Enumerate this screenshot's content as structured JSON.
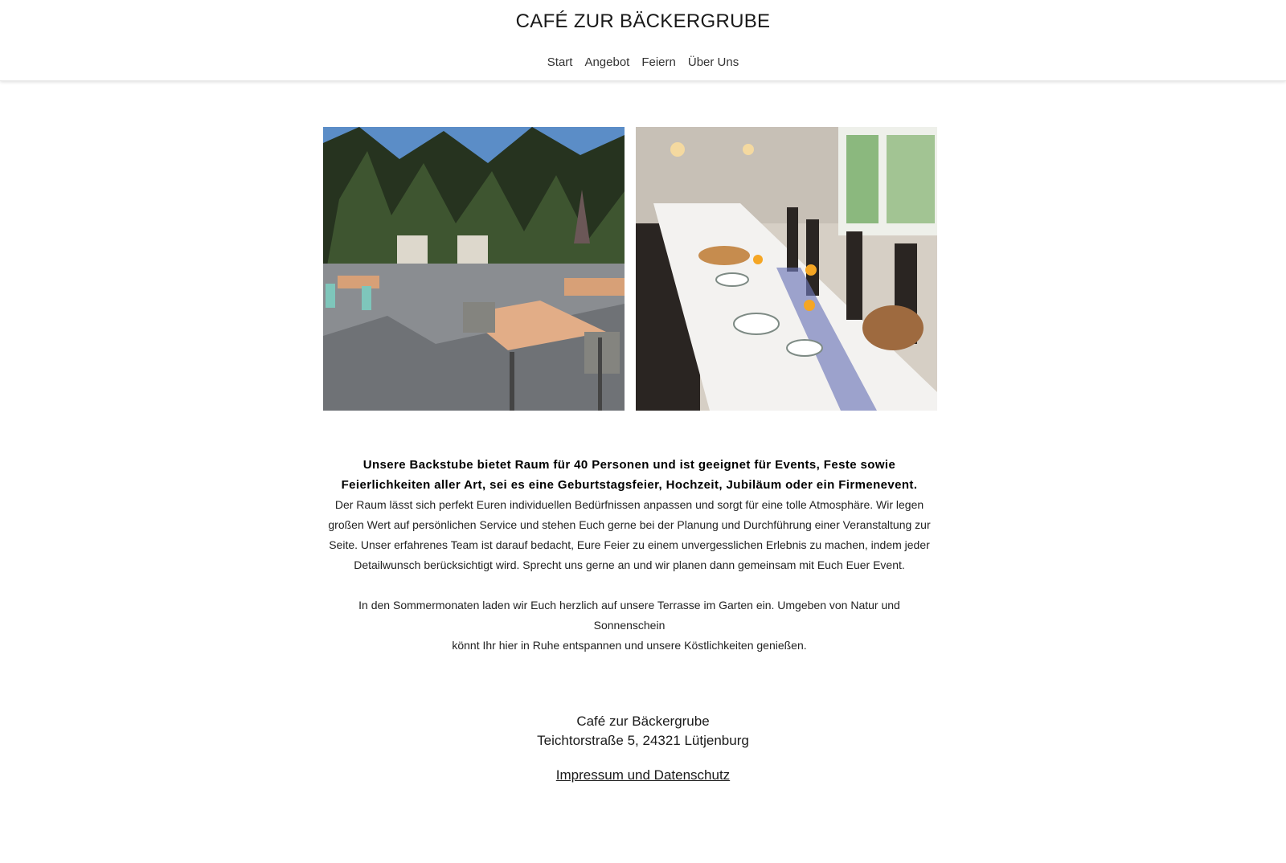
{
  "header": {
    "title": "CAFÉ ZUR BÄCKERGRUBE",
    "nav": [
      "Start",
      "Angebot",
      "Feiern",
      "Über Uns"
    ]
  },
  "intro": {
    "bold_line_1": "Unsere Backstube bietet Raum für 40 Personen und ist geeignet für Events, Feste sowie",
    "bold_line_2": "Feierlichkeiten aller Art, sei es eine Geburtstagsfeier, Hochzeit, Jubiläum oder ein Firmenevent.",
    "line_1": "Der Raum lässt sich perfekt Euren individuellen Bedürfnissen anpassen und sorgt für eine tolle Atmosphäre. Wir legen",
    "line_2": "großen Wert auf persönlichen Service und stehen Euch gerne bei der Planung und Durchführung einer Veranstaltung zur",
    "line_3": "Seite. Unser erfahrenes Team ist darauf bedacht, Eure Feier zu einem unvergesslichen Erlebnis zu machen, indem jeder",
    "line_4": "Detailwunsch berücksichtigt wird. Sprecht uns gerne an und wir planen dann gemeinsam mit Euch Euer Event.",
    "summer_1": "In den Sommermonaten laden wir Euch herzlich auf unsere Terrasse im Garten ein. Umgeben von Natur und Sonnenschein",
    "summer_2": "könnt Ihr hier in Ruhe entspannen und unsere Köstlichkeiten genießen."
  },
  "footer": {
    "name": "Café zur Bäckergrube",
    "address": "Teichtorstraße 5, 24321 Lütjenburg",
    "legal_link": "Impressum und Datenschutz"
  }
}
